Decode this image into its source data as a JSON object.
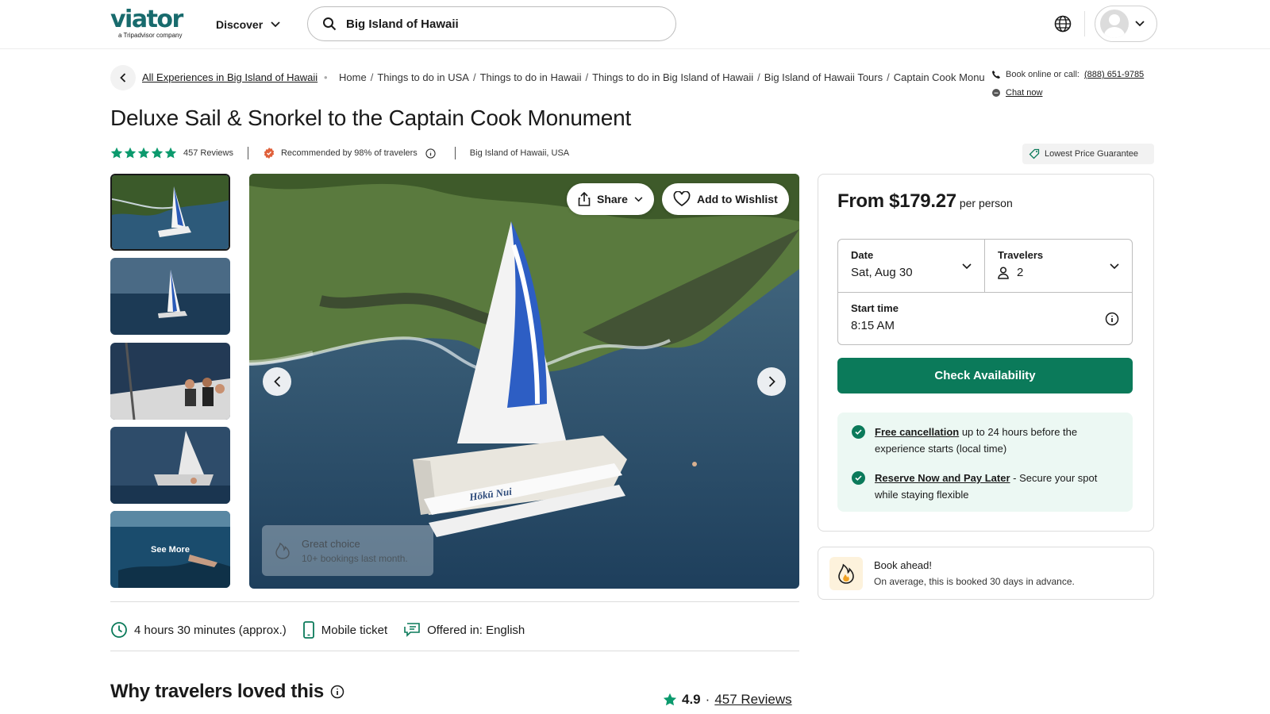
{
  "header": {
    "logo_text": "viator",
    "logo_sub": "a Tripadvisor company",
    "discover_label": "Discover",
    "search_value": "Big Island of Hawaii"
  },
  "breadcrumb": {
    "all_experiences": "All Experiences in Big Island of Hawaii",
    "items": [
      "Home",
      "Things to do in USA",
      "Things to do in Hawaii",
      "Things to do in Big Island of Hawaii",
      "Big Island of Hawaii Tours",
      "Captain Cook Monun"
    ]
  },
  "contact": {
    "book_text": "Book online or call:",
    "phone": "(888) 651-9785",
    "chat_label": "Chat now"
  },
  "product": {
    "title": "Deluxe Sail & Snorkel to the Captain Cook Monument",
    "rating_stars": 5,
    "reviews_label": "457 Reviews",
    "recommended": "Recommended by 98% of travelers",
    "location": "Big Island of Hawaii, USA",
    "lowest_price": "Lowest Price Guarantee"
  },
  "gallery": {
    "see_more": "See More",
    "share_label": "Share",
    "wishlist_label": "Add to Wishlist",
    "boat_name": "Hōkū Nui",
    "badge_title": "Great choice",
    "badge_sub": "10+ bookings last month."
  },
  "booking": {
    "price": "From $179.27",
    "per": "per person",
    "date_label": "Date",
    "date_value": "Sat, Aug 30",
    "travelers_label": "Travelers",
    "travelers_value": "2",
    "start_label": "Start time",
    "start_value": "8:15 AM",
    "check_label": "Check Availability",
    "free_cancel_link": "Free cancellation",
    "free_cancel_text": " up to 24 hours before the experience starts (local time)",
    "reserve_link": "Reserve Now and Pay Later",
    "reserve_text": " - Secure your spot while staying flexible",
    "accent": "#0b7a5a"
  },
  "book_ahead": {
    "title": "Book ahead!",
    "sub": "On average, this is booked 30 days in advance."
  },
  "features": {
    "duration": "4 hours 30 minutes (approx.)",
    "ticket": "Mobile ticket",
    "language": "Offered in: English"
  },
  "why": {
    "heading": "Why travelers loved this",
    "rating": "4.9",
    "dot": "·",
    "reviews_link": "457 Reviews"
  }
}
